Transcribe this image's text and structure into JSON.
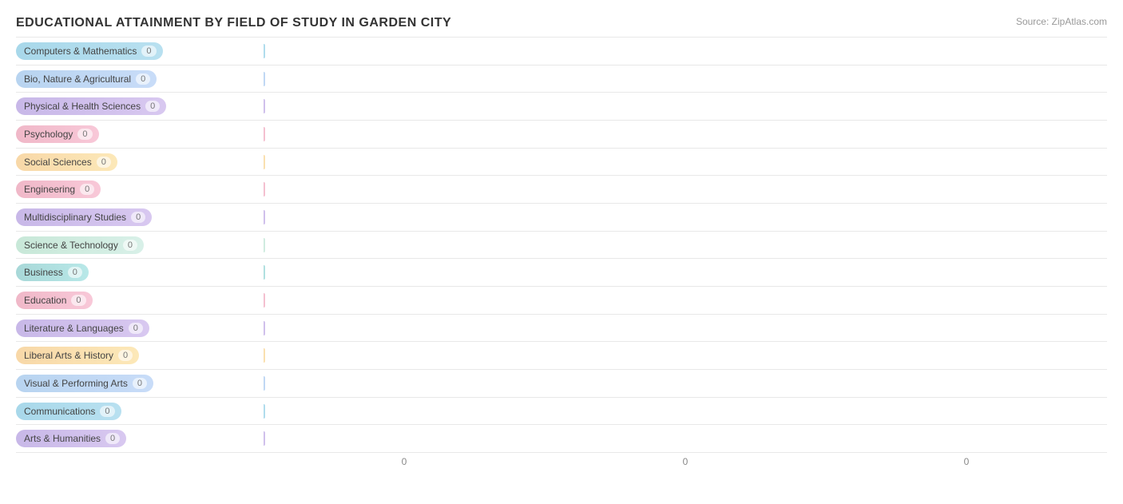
{
  "title": "EDUCATIONAL ATTAINMENT BY FIELD OF STUDY IN GARDEN CITY",
  "source": "Source: ZipAtlas.com",
  "chart": {
    "bars": [
      {
        "label": "Computers & Mathematics",
        "value": 0,
        "colorClass": "color-0"
      },
      {
        "label": "Bio, Nature & Agricultural",
        "value": 0,
        "colorClass": "color-1"
      },
      {
        "label": "Physical & Health Sciences",
        "value": 0,
        "colorClass": "color-2"
      },
      {
        "label": "Psychology",
        "value": 0,
        "colorClass": "color-3"
      },
      {
        "label": "Social Sciences",
        "value": 0,
        "colorClass": "color-4"
      },
      {
        "label": "Engineering",
        "value": 0,
        "colorClass": "color-5"
      },
      {
        "label": "Multidisciplinary Studies",
        "value": 0,
        "colorClass": "color-6"
      },
      {
        "label": "Science & Technology",
        "value": 0,
        "colorClass": "color-7"
      },
      {
        "label": "Business",
        "value": 0,
        "colorClass": "color-8"
      },
      {
        "label": "Education",
        "value": 0,
        "colorClass": "color-9"
      },
      {
        "label": "Literature & Languages",
        "value": 0,
        "colorClass": "color-10"
      },
      {
        "label": "Liberal Arts & History",
        "value": 0,
        "colorClass": "color-11"
      },
      {
        "label": "Visual & Performing Arts",
        "value": 0,
        "colorClass": "color-12"
      },
      {
        "label": "Communications",
        "value": 0,
        "colorClass": "color-13"
      },
      {
        "label": "Arts & Humanities",
        "value": 0,
        "colorClass": "color-14"
      }
    ],
    "xAxisLabels": [
      "0",
      "0",
      "0"
    ]
  }
}
